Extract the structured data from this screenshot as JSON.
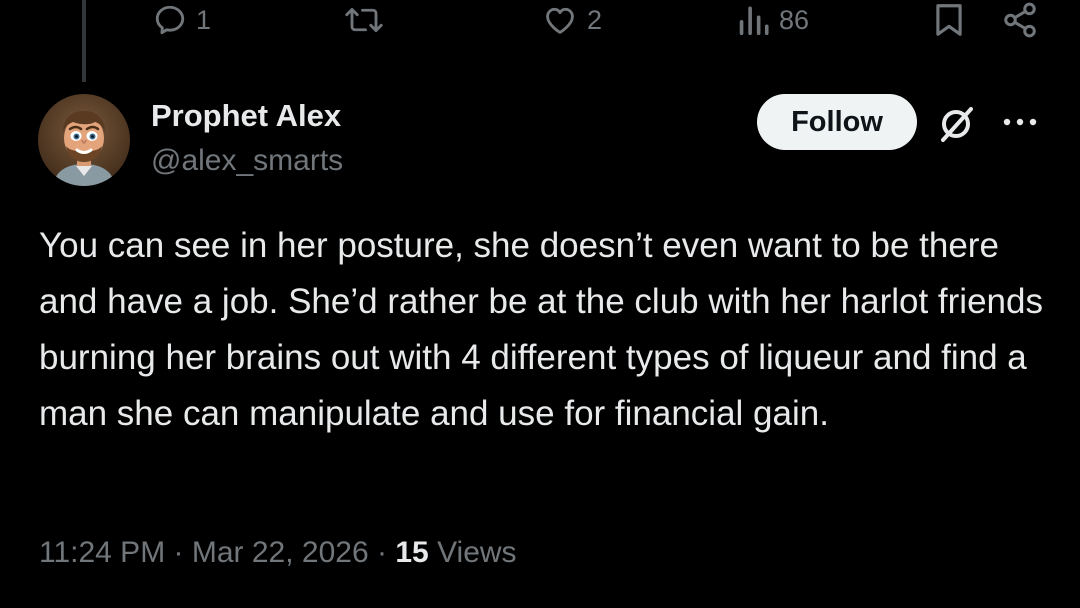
{
  "actions": {
    "reply_count": "1",
    "repost_count": "",
    "like_count": "2",
    "views_count": "86"
  },
  "author": {
    "name": "Prophet Alex",
    "handle": "@alex_smarts",
    "follow_label": "Follow"
  },
  "tweet": {
    "text": "You can see in her posture, she doesn’t even want to be there and have a job. She’d rather be at the club with her harlot friends burning her brains out with 4 different types of liqueur and find a man she can manipulate and use for financial gain."
  },
  "meta": {
    "time": "11:24 PM",
    "separator": "·",
    "date": "Mar 22, 2026",
    "views_count": "15",
    "views_label": "Views"
  },
  "icons": {
    "reply": "reply-icon",
    "repost": "repost-icon",
    "like": "heart-icon",
    "views": "analytics-icon",
    "bookmark": "bookmark-icon",
    "share": "share-icon",
    "grok": "grok-icon",
    "more": "more-icon"
  },
  "colors": {
    "background": "#000000",
    "text_primary": "#e7e9ea",
    "text_secondary": "#71767b",
    "follow_button_bg": "#eff3f4",
    "follow_button_text": "#0f1419",
    "thread_line": "#333639"
  }
}
